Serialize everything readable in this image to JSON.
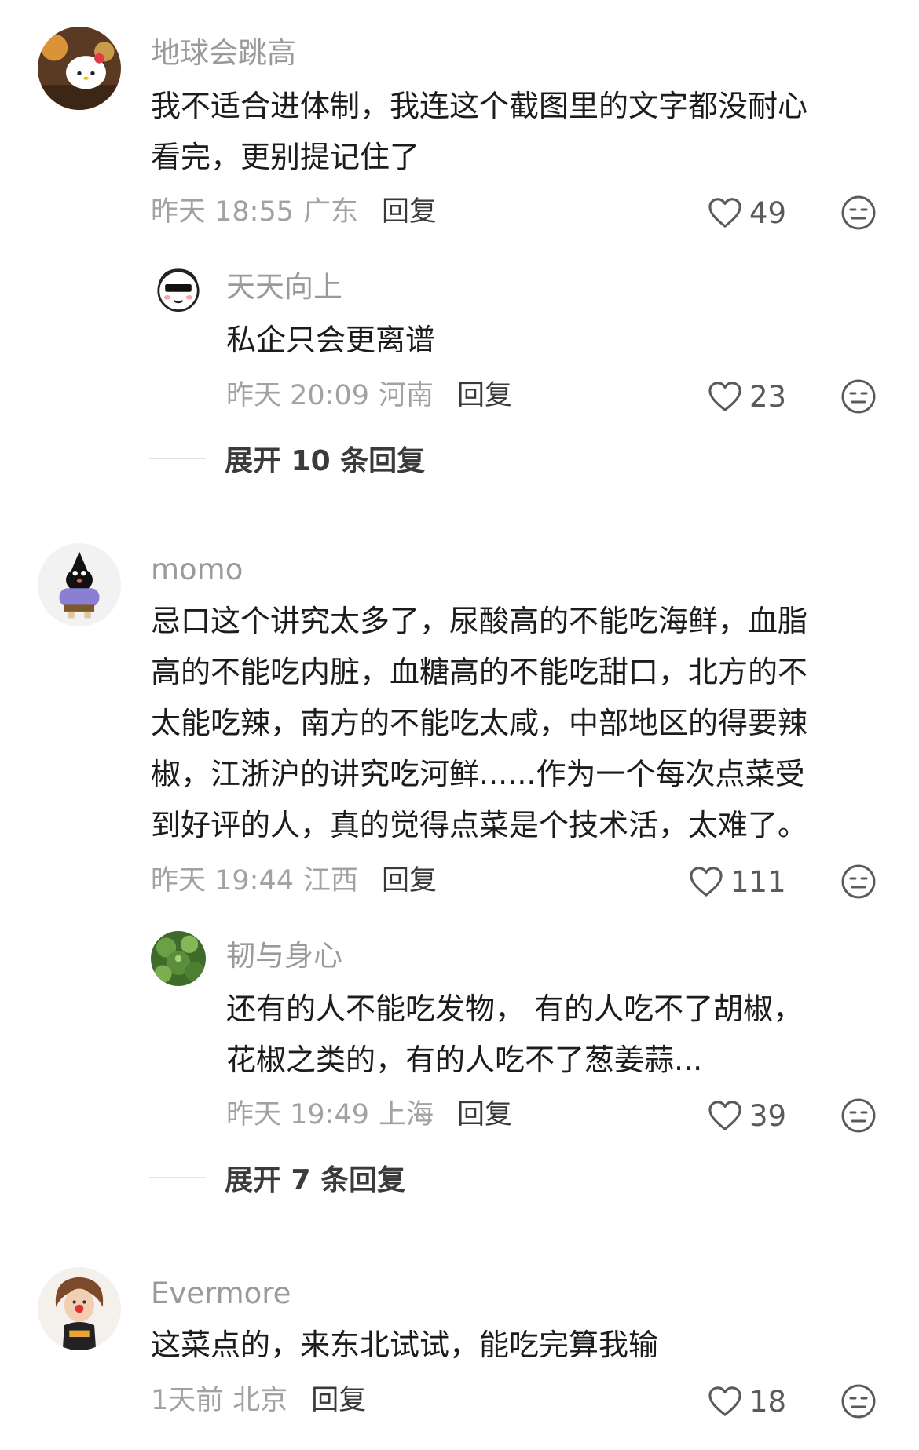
{
  "comments": [
    {
      "user": "地球会跳高",
      "lines": [
        "我不适合进体制，我连这个截图里的文字都没耐心",
        "看完，更别提记住了"
      ],
      "time": "昨天 18:55",
      "location": "广东",
      "reply_label": "回复",
      "likes": "49",
      "replies": [
        {
          "user": "天天向上",
          "lines": [
            "私企只会更离谱"
          ],
          "time": "昨天 20:09",
          "location": "河南",
          "reply_label": "回复",
          "likes": "23"
        }
      ],
      "expand_label": "展开 10 条回复"
    },
    {
      "user": "momo",
      "lines": [
        "忌口这个讲究太多了，尿酸高的不能吃海鲜，血脂",
        "高的不能吃内脏，血糖高的不能吃甜口，北方的不",
        "太能吃辣，南方的不能吃太咸，中部地区的得要辣",
        "椒，江浙沪的讲究吃河鲜......作为一个每次点菜受",
        "到好评的人，真的觉得点菜是个技术活，太难了。"
      ],
      "time": "昨天 19:44",
      "location": "江西",
      "reply_label": "回复",
      "likes": "111",
      "replies": [
        {
          "user": "韧与身心",
          "lines": [
            "还有的人不能吃发物， 有的人吃不了胡椒，",
            "花椒之类的，有的人吃不了葱姜蒜..."
          ],
          "time": "昨天 19:49",
          "location": "上海",
          "reply_label": "回复",
          "likes": "39"
        }
      ],
      "expand_label": "展开 7 条回复"
    },
    {
      "user": "Evermore",
      "lines": [
        "这菜点的，来东北试试，能吃完算我输"
      ],
      "time": "1天前",
      "location": "北京",
      "reply_label": "回复",
      "likes": "18"
    }
  ],
  "icons": {
    "like": "heart-outline-icon",
    "dislike": "unamused-face-icon"
  },
  "colors": {
    "username": "#9a9a9a",
    "body_text": "#1c1c1c",
    "meta": "#a2a2a2"
  }
}
